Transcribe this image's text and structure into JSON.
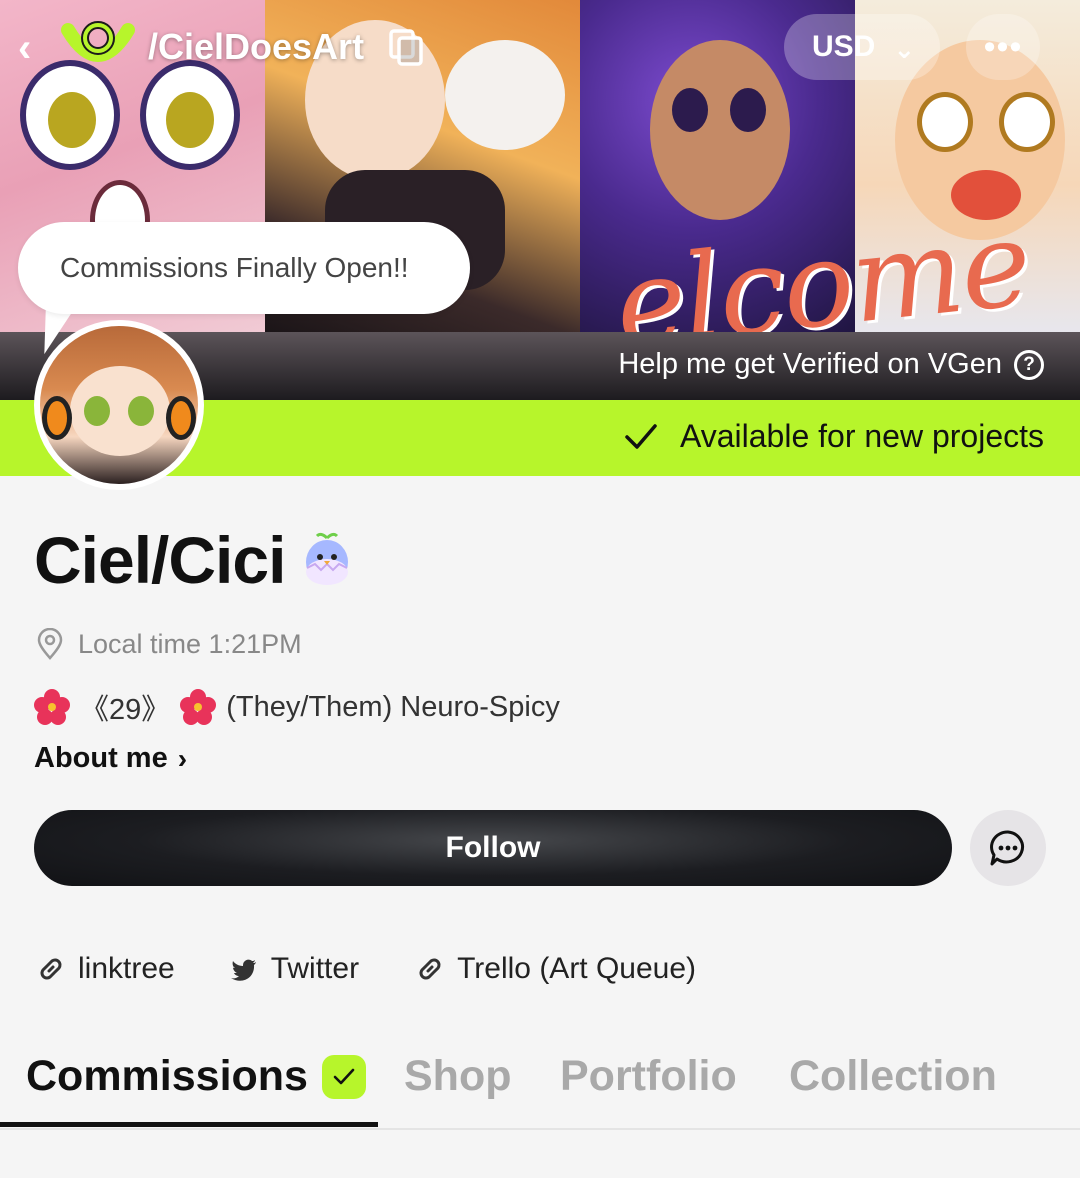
{
  "header": {
    "handle": "/CielDoesArt",
    "currency": "USD"
  },
  "banner": {
    "welcome_text": "elcome",
    "bubble_text": "Commissions Finally Open!!",
    "verify_link": "Help me get Verified on VGen",
    "availability": "Available for new projects"
  },
  "profile": {
    "name": "Ciel/Cici",
    "local_time": "Local time 1:21PM",
    "bio_age": "《29》",
    "bio_rest": "(They/Them) Neuro-Spicy",
    "about_label": "About me",
    "follow_label": "Follow"
  },
  "links": [
    {
      "label": "linktree",
      "icon": "link-icon"
    },
    {
      "label": "Twitter",
      "icon": "twitter-icon"
    },
    {
      "label": "Trello (Art Queue)",
      "icon": "link-icon"
    }
  ],
  "tabs": [
    {
      "label": "Commissions",
      "active": true
    },
    {
      "label": "Shop"
    },
    {
      "label": "Portfolio"
    },
    {
      "label": "Collection"
    }
  ],
  "colors": {
    "accent": "#b7f52b",
    "dark": "#111111"
  }
}
